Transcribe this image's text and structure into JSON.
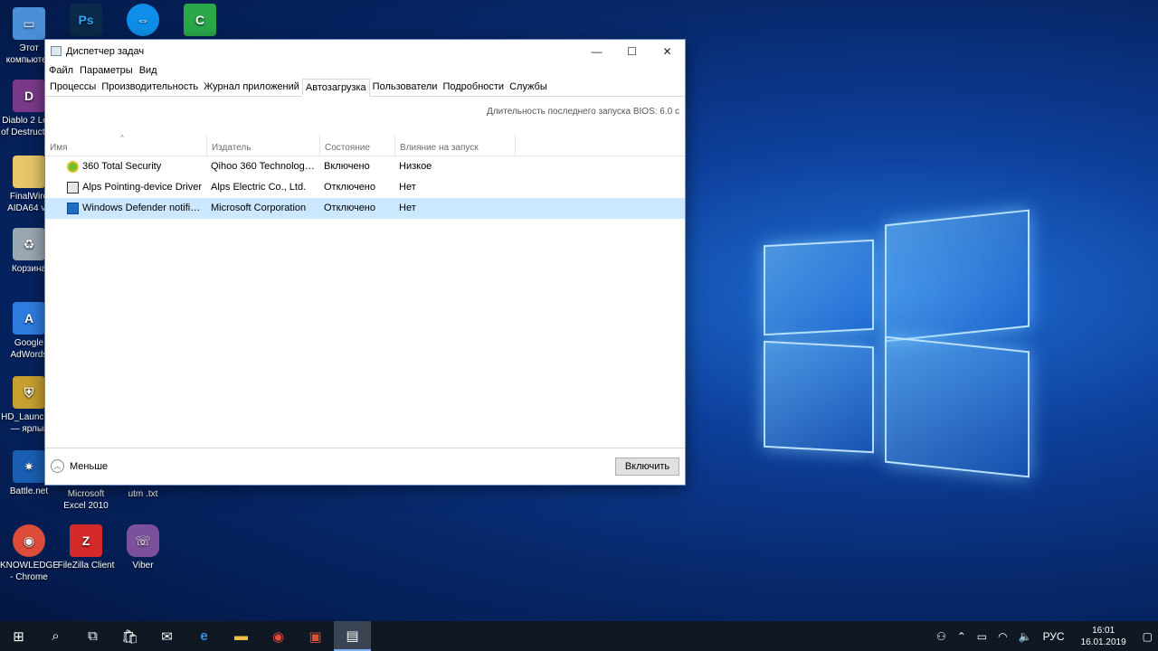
{
  "desktop": {
    "icons": [
      {
        "label": "Этот компьютер",
        "color": "#4a90d9"
      },
      {
        "label": "Diablo 2 Lord of Destruction",
        "color": "#7a3a8a"
      },
      {
        "label": "FinalWire AIDA64 v5",
        "color": "#e8c76a"
      },
      {
        "label": "Корзина",
        "color": "#9aa8b4"
      },
      {
        "label": "Google AdWords",
        "color": "#2f7de1"
      },
      {
        "label": "HD_Launcher — ярлык",
        "color": "#c8a030"
      },
      {
        "label": "Battle.net",
        "color": "#1a5fb4"
      },
      {
        "label": "Microsoft Excel 2010",
        "color": "#1f6f3f"
      },
      {
        "label": "utm .txt",
        "color": "#dddddd"
      },
      {
        "label": "KNOWLEDGE - Chrome",
        "color": "#dd4b39"
      },
      {
        "label": "FileZilla Client",
        "color": "#d42a2a"
      },
      {
        "label": "Viber",
        "color": "#7b519d"
      },
      {
        "label": "Ps",
        "color": "#0b2a4a"
      },
      {
        "label": "TeamViewer",
        "color": "#0e8ee9"
      },
      {
        "label": "Camtasia",
        "color": "#2aa84a"
      }
    ]
  },
  "window": {
    "title": "Диспетчер задач",
    "menu": [
      "Файл",
      "Параметры",
      "Вид"
    ],
    "tabs": [
      "Процессы",
      "Производительность",
      "Журнал приложений",
      "Автозагрузка",
      "Пользователи",
      "Подробности",
      "Службы"
    ],
    "active_tab": 3,
    "bios_label": "Длительность последнего запуска BIOS: 6.0 с",
    "columns": [
      "Имя",
      "Издатель",
      "Состояние",
      "Влияние на запуск"
    ],
    "rows": [
      {
        "name": "360 Total Security",
        "publisher": "Qihoo 360 Technology C...",
        "status": "Включено",
        "impact": "Низкое",
        "icon": "360-icon"
      },
      {
        "name": "Alps Pointing-device Driver",
        "publisher": "Alps Electric Co., Ltd.",
        "status": "Отключено",
        "impact": "Нет",
        "icon": "driver-icon"
      },
      {
        "name": "Windows Defender notificat...",
        "publisher": "Microsoft Corporation",
        "status": "Отключено",
        "impact": "Нет",
        "icon": "defender-icon"
      }
    ],
    "selected_row": 2,
    "less_label": "Меньше",
    "enable_label": "Включить"
  },
  "taskbar": {
    "lang": "РУС",
    "time": "16:01",
    "date": "16.01.2019"
  }
}
